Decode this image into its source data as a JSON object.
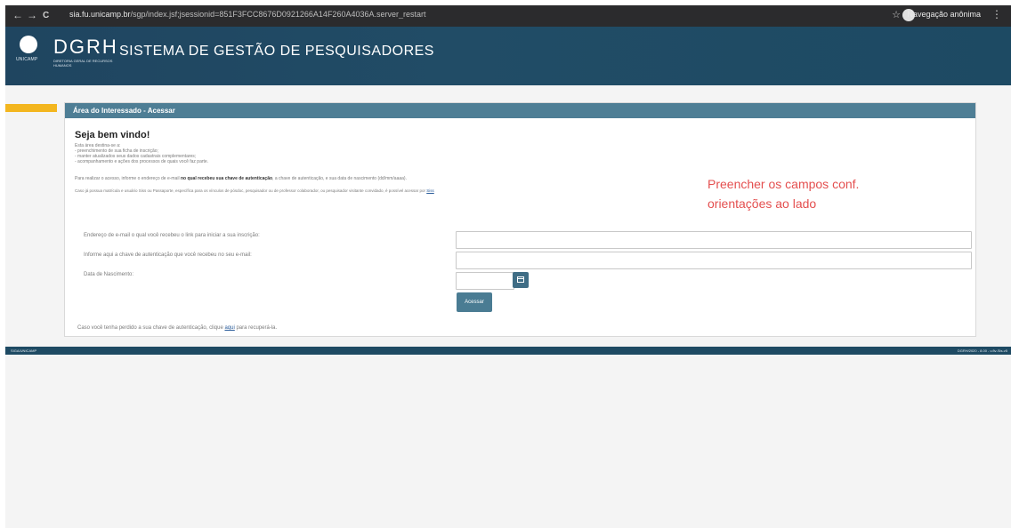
{
  "browser": {
    "back": "←",
    "forward": "→",
    "reload": "C",
    "url_host": "sia.fu.unicamp.br",
    "url_path": "/sgp/index.jsf;jsessionid=851F3FCC8676D0921266A14F260A4036A.server_restart",
    "incognito_label": "Navegação anônima",
    "star": "☆",
    "menu": "⋮"
  },
  "header": {
    "unicamp_label": "UNICAMP",
    "dgrh": "DGRH",
    "dgrh_sub": "DIRETORIA GERAL DE RECURSOS HUMANOS",
    "system_title": "SISTEMA DE GESTÃO DE PESQUISADORES"
  },
  "panel": {
    "title": "Área do Interessado - Acessar",
    "welcome": "Seja bem vindo!",
    "intro_lines": [
      "Esta área destina-se a:",
      "- preenchimento de sua ficha de inscrição;",
      "- manter atualizados seus dados cadastrais complementares;",
      "- acompanhamento e ações dos processos de quais você faz parte."
    ],
    "instruction_prefix": "Para realizar o acesso, informe o endereço de e-mail ",
    "instruction_bold": "no qual recebeu sua chave de autenticação",
    "instruction_suffix": ", a chave de autenticação, e sua data de nascimento (dd/mm/aaaa).",
    "matricula_text": "Caso já possua matrícula e usuário Siss ou Passaporte, específica para os vínculos de pósdoc, pesquisador ou de professor colaborador, ou pesquisador visitante convidado, é possível acessar por",
    "matricula_link": "Siss",
    "annotation_line1": "Preencher os campos conf.",
    "annotation_line2": "orientações ao lado"
  },
  "form": {
    "email_label": "Endereço de e-mail o qual você recebeu o link para iniciar a sua inscrição:",
    "email_value": "",
    "key_label": "Informe aqui a chave de autenticação que você recebeu no seu e-mail:",
    "key_value": "",
    "birth_label": "Data de Nascimento:",
    "birth_value": "",
    "submit_label": "Acessar",
    "lost_prefix": "Caso você tenha perdido a sua chave de autenticação, clique ",
    "lost_link": "aqui",
    "lost_suffix": " para recuperá-la."
  },
  "footer": {
    "left": "SIGA/UNICAMP",
    "right": "DGRH/2020 - 8.00 - v.8v-Sis-v5"
  }
}
